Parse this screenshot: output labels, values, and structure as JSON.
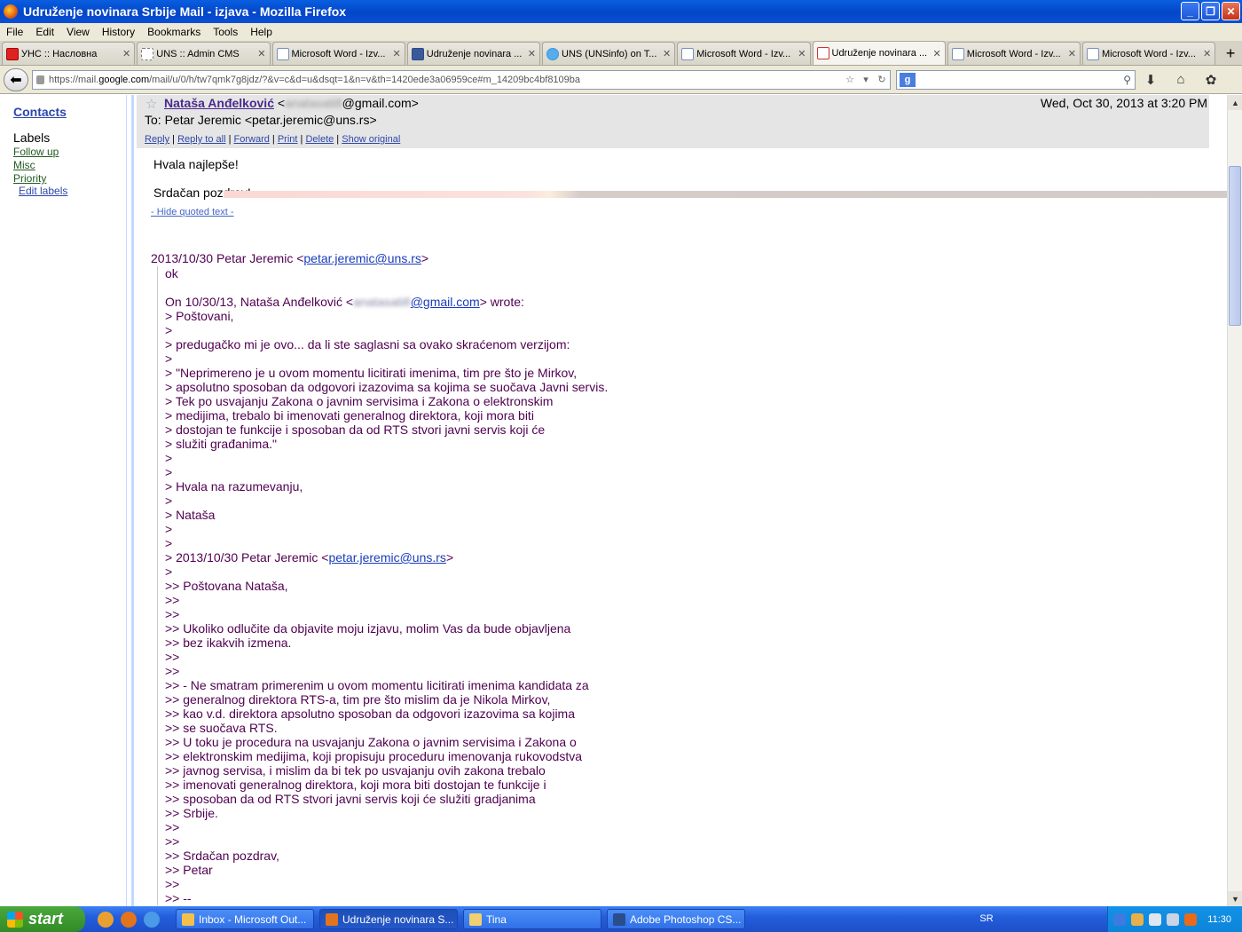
{
  "window": {
    "title": "Udruženje novinara Srbije Mail - izjava - Mozilla Firefox"
  },
  "menu": [
    "File",
    "Edit",
    "View",
    "History",
    "Bookmarks",
    "Tools",
    "Help"
  ],
  "tabs": [
    {
      "label": "УНС :: Насловна",
      "icon": "uns-icon"
    },
    {
      "label": "UNS :: Admin CMS",
      "icon": "dashed-page-icon"
    },
    {
      "label": "Microsoft Word - Izv...",
      "icon": "page-icon"
    },
    {
      "label": "Udruženje novinara ...",
      "icon": "facebook-icon"
    },
    {
      "label": "UNS (UNSinfo) on T...",
      "icon": "twitter-icon"
    },
    {
      "label": "Microsoft Word - Izv...",
      "icon": "page-icon"
    },
    {
      "label": "Udruženje novinara ...",
      "icon": "gmail-icon",
      "active": true
    },
    {
      "label": "Microsoft Word - Izv...",
      "icon": "page-icon"
    },
    {
      "label": "Microsoft Word - Izv...",
      "icon": "page-icon"
    }
  ],
  "nav": {
    "url_prefix": "https://mail.",
    "url_domain": "google.com",
    "url_rest": "/mail/u/0/h/tw7qmk7g8jdz/?&v=c&d=u&dsqt=1&n=v&th=1420ede3a06959ce#m_14209bc4bf8109ba",
    "search_engine": "g"
  },
  "sidebar": {
    "contacts": "Contacts",
    "labels_heading": "Labels",
    "labels": [
      "Follow up",
      "Misc",
      "Priority"
    ],
    "edit_labels": "Edit labels"
  },
  "message": {
    "from_name": "Nataša Anđelković",
    "from_email_hidden": "anatasati8",
    "from_email_domain": "@gmail.com>",
    "date": "Wed, Oct 30, 2013 at 3:20 PM",
    "to": "To: Petar Jeremic <petar.jeremic@uns.rs>",
    "actions": [
      "Reply",
      "Reply to all",
      "Forward",
      "Print",
      "Delete",
      "Show original"
    ],
    "body_lines": [
      "Hvala najlepše!",
      "",
      "Srdačan pozdrav!"
    ],
    "hide_quoted": "- Hide quoted text -",
    "quote_header_prefix": "2013/10/30 Petar Jeremic <",
    "quote_header_link": "petar.jeremic@uns.rs",
    "quote_header_suffix": ">",
    "quote_ok": "ok",
    "quote_on_prefix": "On 10/30/13, Nataša Anđelković <",
    "quote_on_hidden": "anatasati8",
    "quote_on_link": "@gmail.com",
    "quote_on_suffix": "> wrote:",
    "quoted_lines": [
      "> Poštovani,",
      ">",
      "> predugačko mi je ovo... da li ste saglasni sa ovako skraćenom verzijom:",
      ">",
      "> \"Neprimereno je u ovom momentu licitirati imenima, tim pre što je Mirkov,",
      "> apsolutno sposoban da odgovori izazovima sa kojima se suočava Javni servis.",
      "> Tek po usvajanju Zakona o javnim servisima i Zakona o elektronskim",
      "> medijima, trebalo bi imenovati generalnog direktora, koji mora biti",
      "> dostojan te funkcije i sposoban da od RTS stvori javni servis koji će",
      "> služiti građanima.\"",
      ">",
      ">",
      "> Hvala na razumevanju,",
      ">",
      "> Nataša",
      ">",
      ">"
    ],
    "nested_prefix": "> 2013/10/30 Petar Jeremic <",
    "nested_link": "petar.jeremic@uns.rs",
    "nested_suffix": ">",
    "nested_lines": [
      ">",
      ">> Poštovana Nataša,",
      ">>",
      ">>",
      ">> Ukoliko odlučite da objavite moju izjavu, molim Vas da bude objavljena",
      ">> bez ikakvih izmena.",
      ">>",
      ">>",
      ">> - Ne smatram primerenim u ovom momentu licitirati imenima kandidata za",
      ">> generalnog direktora RTS-a, tim pre što mislim da je Nikola Mirkov,",
      ">> kao v.d. direktora apsolutno sposoban da odgovori izazovima sa kojima",
      ">> se suočava RTS.",
      ">> U toku je procedura na usvajanju Zakona o javnim servisima i Zakona o",
      ">> elektronskim medijima, koji propisuju proceduru imenovanja rukovodstva",
      ">> javnog servisa, i mislim da bi tek po usvajanju ovih zakona trebalo",
      ">> imenovati generalnog direktora, koji mora biti dostojan te funkcije i",
      ">> sposoban da od RTS stvori javni servis koji će služiti gradjanima",
      ">> Srbije.",
      ">>",
      ">>",
      ">> Srdačan pozdrav,",
      ">> Petar",
      ">>",
      ">> --"
    ]
  },
  "taskbar": {
    "start": "start",
    "tasks": [
      {
        "label": "Inbox - Microsoft Out..."
      },
      {
        "label": "Udruženje novinara S...",
        "active": true
      },
      {
        "label": "Tina"
      },
      {
        "label": "Adobe Photoshop CS..."
      }
    ],
    "lang": "SR",
    "clock": "11:30"
  }
}
